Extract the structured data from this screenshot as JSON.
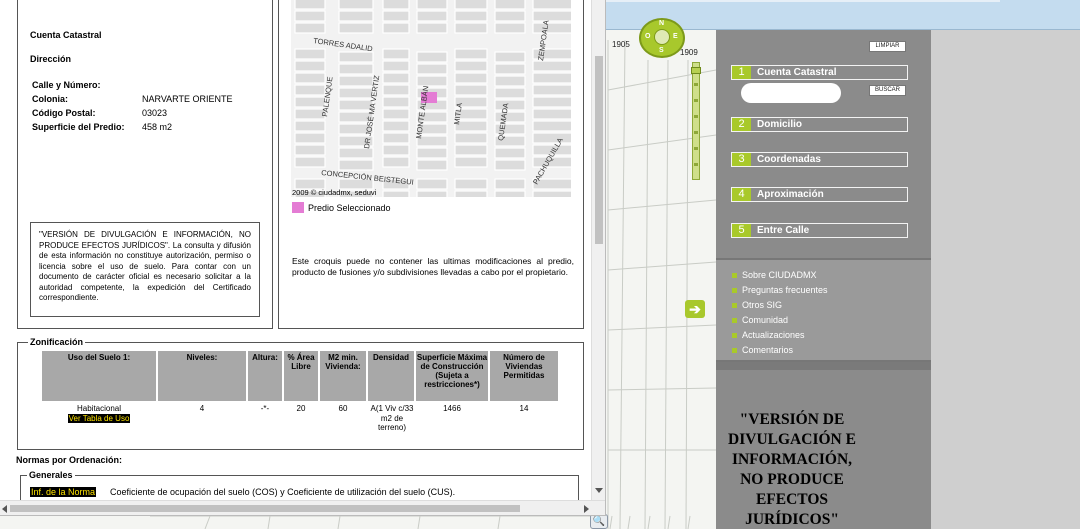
{
  "map": {
    "labels": [
      "1905",
      "1909"
    ],
    "compass": {
      "n": "N",
      "s": "S",
      "w": "O",
      "e": "E"
    },
    "pan_arrow": "➔",
    "zoom_icon": "🔍"
  },
  "info": {
    "title": "Cuenta Catastral",
    "direccion": "Dirección",
    "rows": [
      {
        "label": "Calle y Número:",
        "value": ""
      },
      {
        "label": "Colonia:",
        "value": "NARVARTE ORIENTE"
      },
      {
        "label": "Código Postal:",
        "value": "03023"
      },
      {
        "label": "Superficie del Predio:",
        "value": "458 m2"
      }
    ],
    "disclaimer": "\"VERSIÓN DE DIVULGACIÓN E INFORMACIÓN, NO PRODUCE EFECTOS JURÍDICOS\". La consulta y difusión de esta información no constituye autorización, permiso o licencia sobre el uso de suelo. Para contar con un documento de carácter oficial es necesario solicitar a la autoridad competente, la expedición del Certificado correspondiente."
  },
  "croquis": {
    "streets": [
      "TORRES ADALID",
      "PALENQUE",
      "DR JOSÉ MA VERTIZ",
      "MONTE ALBÁN",
      "MITLA",
      "QUEMADA",
      "ZEMPOALA",
      "PACHUQUILLA",
      "CONCEPCIÓN BEISTEGUI"
    ],
    "credit": "2009 © ciudadmx, seduvi",
    "legend": "Predio Seleccionado",
    "selected_color": "#e47cd4",
    "note": "Este croquis puede no contener las ultimas modificaciones al predio, producto de fusiones y/o subdivisiones llevadas a cabo por el propietario."
  },
  "zonificacion": {
    "title": "Zonificación",
    "headers": [
      "Uso del Suelo 1:",
      "Niveles:",
      "Altura:",
      "% Área Libre",
      "M2 min. Vivienda:",
      "Densidad",
      "Superficie Máxima de Construcción (Sujeta a restricciones*)",
      "Número de Viviendas Permitidas"
    ],
    "row": {
      "uso": "Habitacional",
      "uso_link": "Ver Tabla de Uso",
      "niveles": "4",
      "altura": "-*-",
      "area_libre": "20",
      "m2_min": "60",
      "densidad": "A(1 Viv c/33 m2 de terreno)",
      "superficie": "1466",
      "viviendas": "14"
    }
  },
  "normas": {
    "title": "Normas por Ordenación:",
    "generales_title": "Generales",
    "link": "Inf. de la Norma",
    "text": "Coeficiente de ocupación del suelo (COS) y Coeficiente de utilización del suelo (CUS)."
  },
  "panel": {
    "limpiar": "LIMPIAR",
    "buscar": "BUSCAR",
    "accent": "#a9c92a",
    "search_items": [
      {
        "num": "1",
        "label": "Cuenta Catastral"
      },
      {
        "num": "2",
        "label": "Domicilio"
      },
      {
        "num": "3",
        "label": "Coordenadas"
      },
      {
        "num": "4",
        "label": "Aproximación"
      },
      {
        "num": "5",
        "label": "Entre Calle"
      }
    ],
    "links": [
      "Sobre CIUDADMX",
      "Preguntas frecuentes",
      "Otros SIG",
      "Comunidad",
      "Actualizaciones",
      "Comentarios"
    ],
    "disclaimer_large": "\"VERSIÓN DE\nDIVULGACIÓN E\nINFORMACIÓN,\nNO PRODUCE\nEFECTOS\nJURÍDICOS\""
  }
}
